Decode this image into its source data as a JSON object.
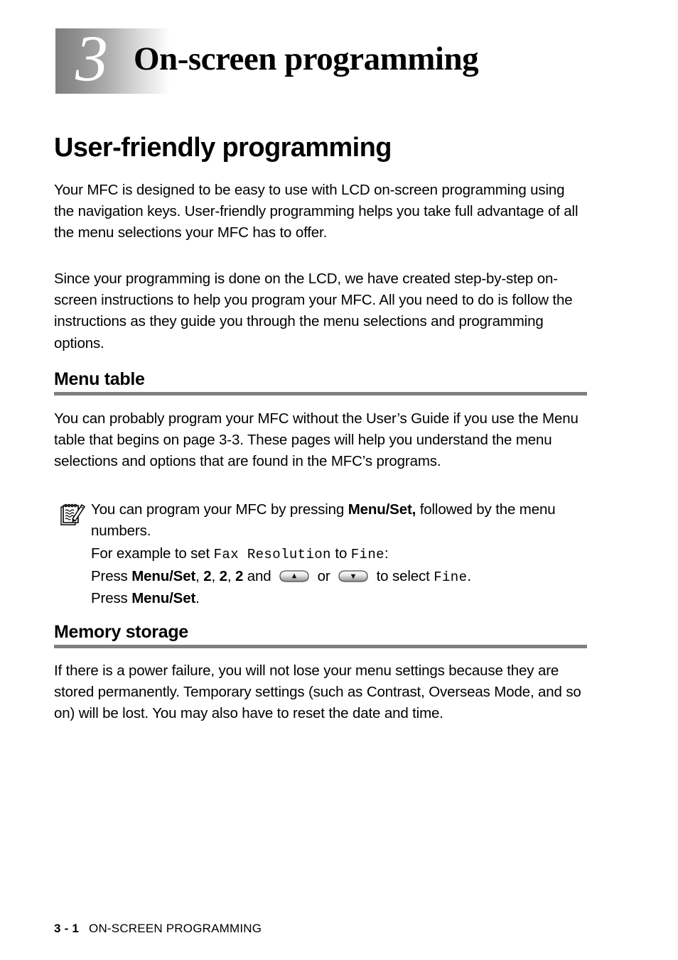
{
  "chapter": {
    "number": "3",
    "title": "On-screen programming"
  },
  "sections": {
    "user_friendly": {
      "heading": "User-friendly programming",
      "paragraph_1": "Your MFC is designed to be easy to use with LCD on-screen programming using the navigation keys. User-friendly programming helps you take full advantage of all the menu selections your MFC has to offer.",
      "paragraph_2": "Since your programming is done on the LCD, we have created step-by-step on-screen instructions to help you program your MFC. All you need to do is follow the instructions as they guide you through the menu selections and programming options."
    },
    "menu_table": {
      "heading": "Menu table",
      "paragraph": "You can probably program your MFC without the User’s Guide if you use the Menu table that begins on page 3-3. These pages will help you understand the menu selections and options that are found in the MFC’s programs.",
      "note": {
        "icon": "note-pencil-icon",
        "line_1_part_1": "You can program your MFC by pressing ",
        "line_1_bold": "Menu/Set,",
        "line_1_part_2": " followed by the menu numbers.",
        "example_line_prefix": "For example to set ",
        "example_setting": "Fax Resolution",
        "example_mid": " to ",
        "example_value": "Fine",
        "example_suffix": ":",
        "press_label_1": "Press ",
        "press_key_1": "Menu/Set",
        "press_comma_1": ", ",
        "digit_1": "2",
        "digit_sep_1": ", ",
        "digit_2": "2",
        "digit_sep_2": ", ",
        "digit_3": "2",
        "press_and": " and ",
        "key_up_icon": "nav-key-up-icon",
        "or_label": " or ",
        "key_down_icon": "nav-key-down-icon",
        "select_label": " to select ",
        "select_value": "Fine",
        "select_suffix": ".",
        "press_label_2": "Press ",
        "press_key_2": "Menu/Set",
        "press_period_2": "."
      }
    },
    "memory_storage": {
      "heading": "Memory storage",
      "paragraph": "If there is a power failure, you will not lose your menu settings because they are stored permanently. Temporary settings (such as Contrast, Overseas Mode, and so on) will be lost. You may also have to reset the date and time."
    }
  },
  "footer": {
    "page_number": "3 - 1",
    "chapter_label": "ON-SCREEN PROGRAMMING"
  },
  "colors": {
    "rule": "#808080",
    "badge_start": "#7f7f7f",
    "badge_end": "#ffffff",
    "text": "#000000"
  }
}
